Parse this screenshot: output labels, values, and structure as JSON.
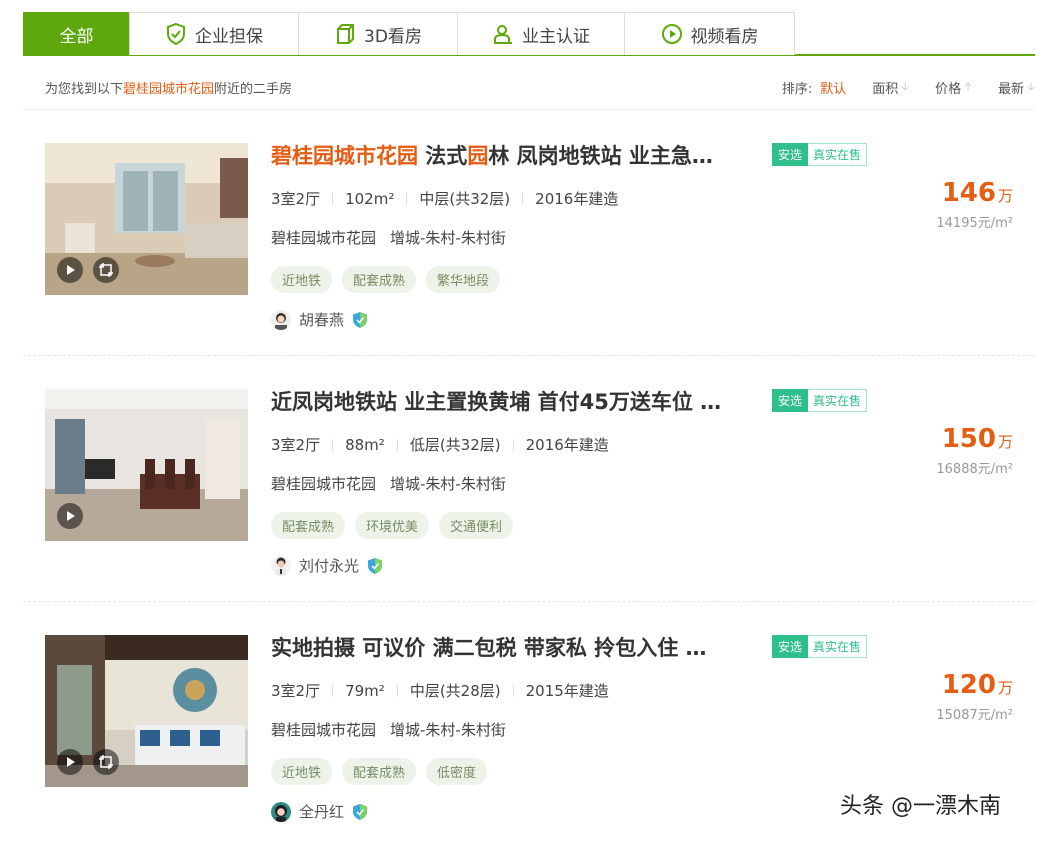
{
  "tabs": [
    {
      "label": "全部",
      "icon": "",
      "active": true
    },
    {
      "label": "企业担保",
      "icon": "shield-check-icon"
    },
    {
      "label": "3D看房",
      "icon": "cube-icon"
    },
    {
      "label": "业主认证",
      "icon": "person-verify-icon"
    },
    {
      "label": "视频看房",
      "icon": "play-circle-icon"
    }
  ],
  "sortbar": {
    "prefix": "为您找到以下",
    "community": "碧桂园城市花园",
    "suffix": "附近的二手房",
    "sort_label": "排序:",
    "options": [
      "默认",
      "面积",
      "价格",
      "最新"
    ]
  },
  "listings": [
    {
      "title_hl1": "碧桂园城市花园",
      "title_mid": " 法式",
      "title_hl2": "园",
      "title_rest": "林 凤岗地铁站 业主急…",
      "badge1": "安选",
      "badge2": "真实在售",
      "layout": "3室2厅",
      "area": "102m²",
      "floor": "中层(共32层)",
      "year": "2016年建造",
      "community": "碧桂园城市花园",
      "district": "增城-朱村-朱村街",
      "tags": [
        "近地铁",
        "配套成熟",
        "繁华地段"
      ],
      "agent": "胡春燕",
      "price": "146",
      "price_unit": "万",
      "unit_price": "14195元/m²"
    },
    {
      "title_hl1": "",
      "title_mid": "近凤岗地铁站 业主置换黄埔 首付45万送车位 …",
      "title_hl2": "",
      "title_rest": "",
      "badge1": "安选",
      "badge2": "真实在售",
      "layout": "3室2厅",
      "area": "88m²",
      "floor": "低层(共32层)",
      "year": "2016年建造",
      "community": "碧桂园城市花园",
      "district": "增城-朱村-朱村街",
      "tags": [
        "配套成熟",
        "环境优美",
        "交通便利"
      ],
      "agent": "刘付永光",
      "price": "150",
      "price_unit": "万",
      "unit_price": "16888元/m²"
    },
    {
      "title_hl1": "",
      "title_mid": "实地拍摄 可议价 满二包税 带家私 拎包入住 …",
      "title_hl2": "",
      "title_rest": "",
      "badge1": "安选",
      "badge2": "真实在售",
      "layout": "3室2厅",
      "area": "79m²",
      "floor": "中层(共28层)",
      "year": "2015年建造",
      "community": "碧桂园城市花园",
      "district": "增城-朱村-朱村街",
      "tags": [
        "近地铁",
        "配套成熟",
        "低密度"
      ],
      "agent": "全丹红",
      "price": "120",
      "price_unit": "万",
      "unit_price": "15087元/m²"
    }
  ],
  "watermark": "头条 @一漂木南",
  "colors": {
    "green": "#5ea80d",
    "orange": "#e55c13",
    "badge": "#2fbf8b"
  }
}
